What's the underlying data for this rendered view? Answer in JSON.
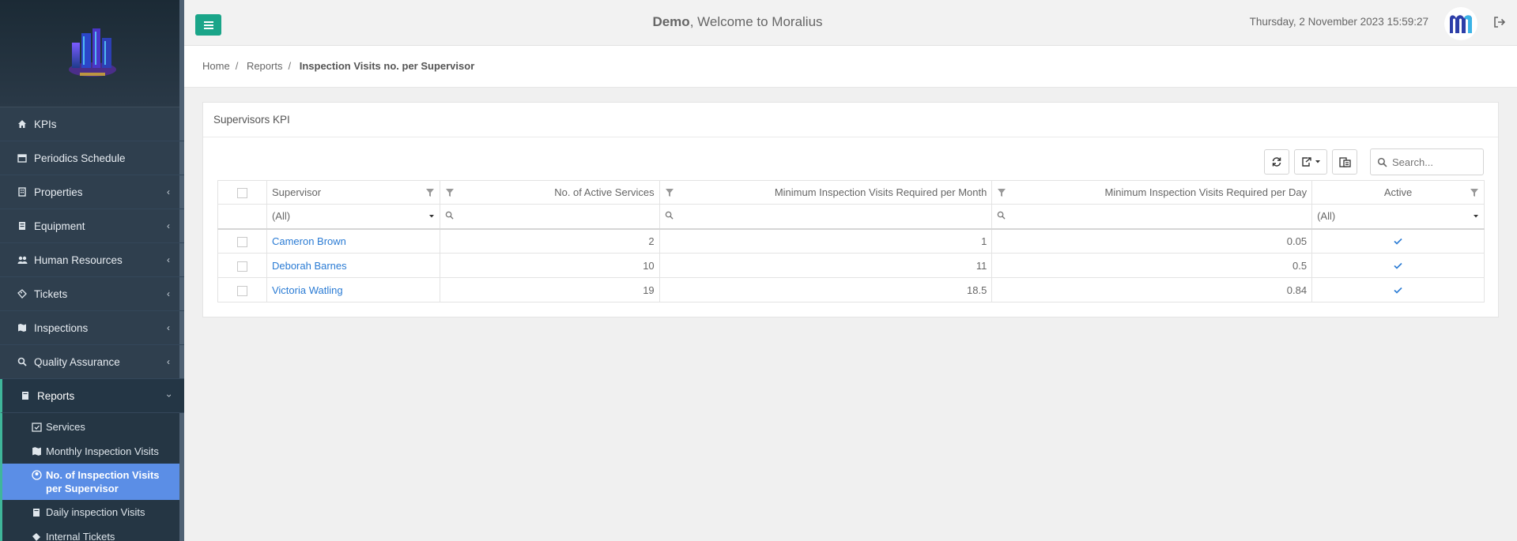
{
  "app": {
    "user": "Demo",
    "welcome_suffix": ", Welcome to Moralius",
    "datetime": "Thursday, 2 November 2023 15:59:27",
    "accent": "#1aa589"
  },
  "sidebar": {
    "items": [
      {
        "label": "KPIs",
        "icon": "home-icon"
      },
      {
        "label": "Periodics Schedule",
        "icon": "calendar-icon"
      },
      {
        "label": "Properties",
        "icon": "building-icon"
      },
      {
        "label": "Equipment",
        "icon": "equipment-icon"
      },
      {
        "label": "Human Resources",
        "icon": "users-icon"
      },
      {
        "label": "Tickets",
        "icon": "tickets-icon"
      },
      {
        "label": "Inspections",
        "icon": "map-icon"
      },
      {
        "label": "Quality Assurance",
        "icon": "search-icon"
      },
      {
        "label": "Reports",
        "icon": "book-icon"
      }
    ],
    "reports_sub": [
      {
        "label": "Services",
        "icon": "calendar-check-icon"
      },
      {
        "label": "Monthly Inspection Visits",
        "icon": "map-icon"
      },
      {
        "label": "No. of Inspection Visits per Supervisor",
        "icon": "user-circle-icon"
      },
      {
        "label": "Daily inspection Visits",
        "icon": "book-icon"
      },
      {
        "label": "Internal Tickets",
        "icon": "tag-icon"
      }
    ]
  },
  "breadcrumb": {
    "home": "Home",
    "reports": "Reports",
    "current": "Inspection Visits no. per Supervisor"
  },
  "panel": {
    "title": "Supervisors KPI",
    "search_placeholder": "Search..."
  },
  "table": {
    "columns": [
      "Supervisor",
      "No. of Active Services",
      "Minimum Inspection Visits Required per Month",
      "Minimum Inspection Visits Required per Day",
      "Active"
    ],
    "filter_all": "(All)",
    "rows": [
      {
        "supervisor": "Cameron Brown",
        "services": "2",
        "per_month": "1",
        "per_day": "0.05",
        "active": true
      },
      {
        "supervisor": "Deborah Barnes",
        "services": "10",
        "per_month": "11",
        "per_day": "0.5",
        "active": true
      },
      {
        "supervisor": "Victoria Watling",
        "services": "19",
        "per_month": "18.5",
        "per_day": "0.84",
        "active": true
      }
    ]
  }
}
